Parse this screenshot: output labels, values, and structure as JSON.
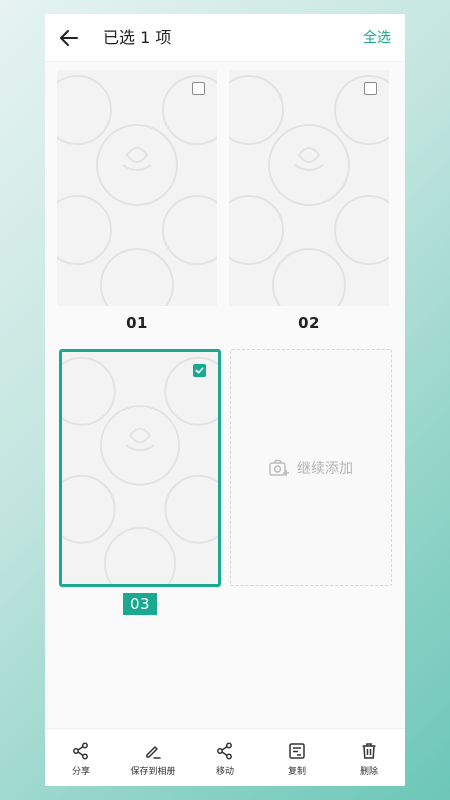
{
  "header": {
    "title": "已选 1 项",
    "select_all_label": "全选"
  },
  "colors": {
    "accent": "#1aa88f",
    "background_gradient_end": "#6cc7b8"
  },
  "documents": [
    {
      "label": "01",
      "selected": false,
      "icon": "checkbox-empty-icon"
    },
    {
      "label": "02",
      "selected": false,
      "icon": "checkbox-empty-icon"
    },
    {
      "label": "03",
      "selected": true,
      "icon": "checkbox-checked-icon"
    }
  ],
  "add_card": {
    "label": "继续添加",
    "icon": "camera-add-icon"
  },
  "toolbar": {
    "items": [
      {
        "label": "分享",
        "icon": "share-icon"
      },
      {
        "label": "保存到相册",
        "icon": "pen-icon"
      },
      {
        "label": "移动",
        "icon": "share-icon"
      },
      {
        "label": "复制",
        "icon": "copy-icon"
      },
      {
        "label": "删除",
        "icon": "trash-icon"
      }
    ]
  }
}
